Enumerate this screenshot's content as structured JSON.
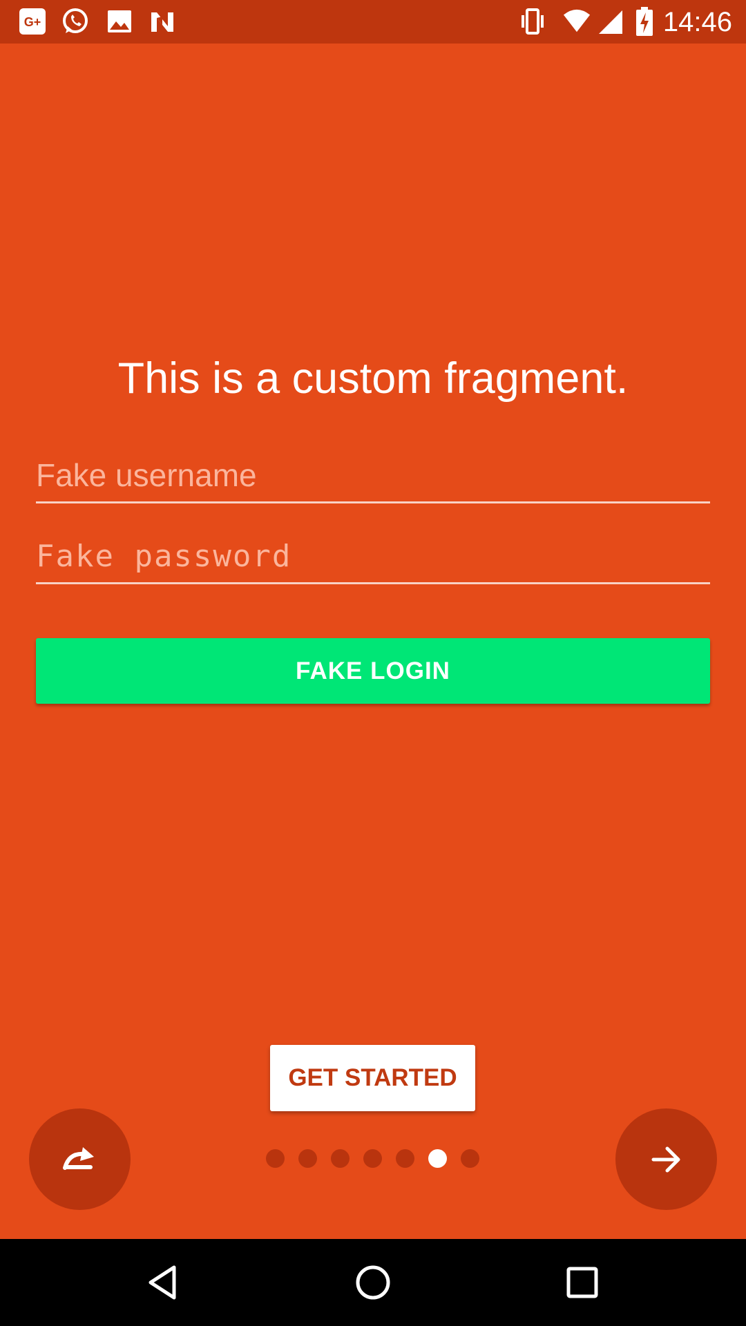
{
  "status_bar": {
    "time": "14:46",
    "left_icons": [
      "google-plus-icon",
      "whatsapp-icon",
      "image-icon",
      "n-app-icon"
    ],
    "right_icons": [
      "vibrate-icon",
      "wifi-icon",
      "cell-signal-icon",
      "battery-charging-icon"
    ]
  },
  "main": {
    "headline": "This is a custom fragment.",
    "username_placeholder": "Fake username",
    "password_placeholder": "Fake password",
    "login_label": "FAKE LOGIN"
  },
  "footer": {
    "get_started_label": "GET STARTED",
    "skip_icon": "redo-arrow-icon",
    "next_icon": "arrow-right-icon",
    "page_indicator": {
      "total": 7,
      "active_index": 5
    }
  },
  "nav_bar": {
    "icons": [
      "back-icon",
      "home-icon",
      "recents-icon"
    ]
  },
  "colors": {
    "background": "#E54B19",
    "status_bar": "#BE360E",
    "accent_button": "#00E676",
    "dark_circle": "#B9340E",
    "get_started_text": "#C03A11"
  }
}
